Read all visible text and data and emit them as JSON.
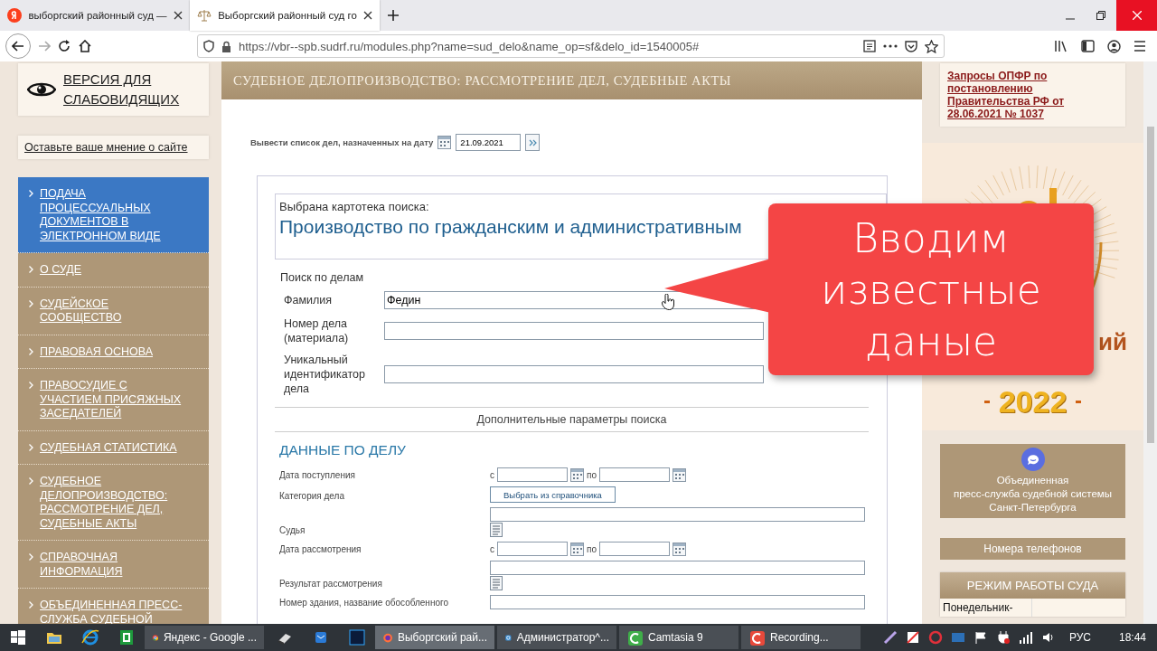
{
  "browser": {
    "tabs": [
      {
        "title": "выборгский районный суд —",
        "selected": false,
        "kind": "yandex"
      },
      {
        "title": "Выборгский районный суд го",
        "selected": true,
        "kind": "scales"
      }
    ],
    "url": "https://vbr--spb.sudrf.ru/modules.php?name=sud_delo&name_op=sf&delo_id=1540005#"
  },
  "sidebar": {
    "accessibility_link": "ВЕРСИЯ ДЛЯ СЛАБОВИДЯЩИХ",
    "feedback_link": "Оставьте ваше мнение о сайте",
    "menu": [
      {
        "label": "ПОДАЧА ПРОЦЕССУАЛЬНЫХ ДОКУМЕНТОВ В ЭЛЕКТРОННОМ ВИДЕ",
        "selected": true
      },
      {
        "label": "О СУДЕ",
        "selected": false
      },
      {
        "label": "СУДЕЙСКОЕ СООБЩЕСТВО",
        "selected": false
      },
      {
        "label": "ПРАВОВАЯ ОСНОВА",
        "selected": false
      },
      {
        "label": "ПРАВОСУДИЕ С УЧАСТИЕМ ПРИСЯЖНЫХ ЗАСЕДАТЕЛЕЙ",
        "selected": false
      },
      {
        "label": "СУДЕБНАЯ СТАТИСТИКА",
        "selected": false
      },
      {
        "label": "СУДЕБНОЕ ДЕЛОПРОИЗВОДСТВО: РАССМОТРЕНИЕ ДЕЛ, СУДЕБНЫЕ АКТЫ",
        "selected": false
      },
      {
        "label": "СПРАВОЧНАЯ ИНФОРМАЦИЯ",
        "selected": false
      },
      {
        "label": "ОБЪЕДИНЕННАЯ ПРЕСС-СЛУЖБА СУДЕБНОЙ",
        "selected": false
      }
    ]
  },
  "main": {
    "header": "СУДЕБНОЕ ДЕЛОПРОИЗВОДСТВО: РАССМОТРЕНИЕ ДЕЛ, СУДЕБНЫЕ АКТЫ",
    "date_filter": {
      "label": "Вывести список дел, назначенных на дату",
      "value": "21.09.2021"
    },
    "search_card": {
      "caption": "Выбрана картотека поиска:",
      "title": "Производство по гражданским и административным"
    },
    "search_section": "Поиск по делам",
    "fields": [
      {
        "label": "Фамилия",
        "value": "Федин"
      },
      {
        "label": "Номер дела (материала)"
      },
      {
        "label": "Уникальный идентификатор дела"
      }
    ],
    "extra_params": "Дополнительные параметры поиска",
    "case_data": {
      "heading": "ДАННЫЕ ПО ДЕЛУ",
      "rows": [
        {
          "kind": "date_range",
          "label": "Дата поступления",
          "from": "с",
          "to": "по"
        },
        {
          "kind": "catalog",
          "label": "Категория дела",
          "button": "Выбрать из справочника"
        },
        {
          "kind": "list",
          "label": "Судья"
        },
        {
          "kind": "date_range",
          "label": "Дата рассмотрения",
          "from": "с",
          "to": "по"
        },
        {
          "kind": "list",
          "label": "Результат рассмотрения"
        },
        {
          "kind": "field",
          "label": "Номер здания, название обособленного"
        }
      ]
    }
  },
  "right": {
    "notice_link": "Запросы ОПФР по постановлению Правительства РФ от 28.06.2021 № 1037",
    "emblem_fragment": "ий",
    "emblem_year": "2022",
    "press_service": [
      "Объединенная",
      "пресс-служба судебной системы",
      "Санкт-Петербурга"
    ],
    "phones": "Номера телефонов",
    "work_hours": {
      "heading": "РЕЖИМ РАБОТЫ СУДА",
      "first_day": "Понедельник-"
    }
  },
  "callout": {
    "lines": [
      "Вводим",
      "известные",
      "даные"
    ]
  },
  "taskbar": {
    "pinned": [
      {
        "kind": "folder"
      },
      {
        "kind": "ie"
      },
      {
        "kind": "sheet"
      }
    ],
    "windows": [
      {
        "kind": "chrome",
        "label": "Яндекс - Google ...",
        "selected": false
      },
      {
        "kind": "scanner"
      },
      {
        "kind": "mail"
      },
      {
        "kind": "ps"
      },
      {
        "kind": "firefox",
        "label": "Выборгский рай...",
        "selected": true
      },
      {
        "kind": "remote",
        "label": "Администратор^...",
        "selected": false
      },
      {
        "kind": "camtasia",
        "label": "Camtasia 9",
        "selected": false
      },
      {
        "kind": "recorder",
        "label": "Recording...",
        "selected": false
      }
    ],
    "language": "РУС",
    "time": "18:44"
  }
}
